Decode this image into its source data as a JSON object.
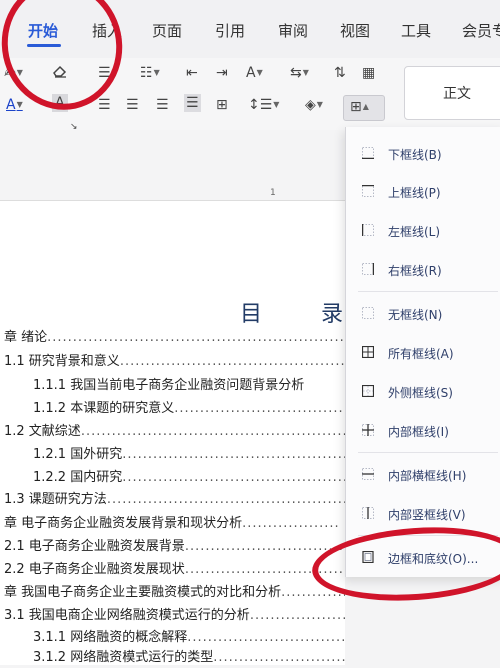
{
  "menu": {
    "items": [
      "开始",
      "插入",
      "页面",
      "引用",
      "审阅",
      "视图",
      "工具",
      "会员专"
    ],
    "active": "开始"
  },
  "toolbar": {
    "style_label": "正文",
    "icons": [
      "format-painter-icon",
      "eraser-icon",
      "bullet-list-icon",
      "number-list-icon",
      "outdent-icon",
      "indent-icon",
      "font-size-icon",
      "sort-icon",
      "text-direction-icon",
      "table-icon",
      "font-color-icon",
      "highlight-icon",
      "align-left-icon",
      "align-center-icon",
      "align-right-icon",
      "justify-icon",
      "distribute-icon",
      "line-spacing-icon",
      "shading-icon",
      "border-icon"
    ]
  },
  "ruler": {
    "marker": "1"
  },
  "document": {
    "toc_title": "目  录",
    "entries": [
      {
        "text": "章  绪论",
        "dots": "........................................................................"
      },
      {
        "text": "1.1    研究背景和意义",
        "dots": "................................................................"
      },
      {
        "text": "1.1.1 我国当前电子商务企业融资问题背景分析",
        "dots": ""
      },
      {
        "text": "1.1.2 本课题的研究意义",
        "dots": "................................................"
      },
      {
        "text": "1.2 文献综述",
        "dots": "........................................................................."
      },
      {
        "text": "1.2.1 国外研究",
        "dots": "..........................................................."
      },
      {
        "text": "1.2.2 国内研究",
        "dots": "..........................................................."
      },
      {
        "text": "1.3 课题研究方法",
        "dots": "..................................................................."
      },
      {
        "text": "章  电子商务企业融资发展背景和现状分析",
        "dots": "..................."
      },
      {
        "text": "2.1  电子商务企业融资发展背景",
        "dots": "........................................"
      },
      {
        "text": "2.2  电子商务企业融资发展现状",
        "dots": "........................................"
      },
      {
        "text": "章  我国电子商务企业主要融资模式的对比和分析",
        "dots": "....................."
      },
      {
        "text": "3.1  我国电商企业网络融资模式运行的分析",
        "dots": "......................"
      },
      {
        "text": "3.1.1 网络融资的概念解释",
        "dots": "............................................"
      },
      {
        "text": "3.1.2  网络融资模式运行的类型",
        "dots": "...................................."
      }
    ]
  },
  "border_menu": {
    "items": [
      {
        "label": "下框线(B)",
        "icon": "bottom-border-icon"
      },
      {
        "label": "上框线(P)",
        "icon": "top-border-icon"
      },
      {
        "label": "左框线(L)",
        "icon": "left-border-icon"
      },
      {
        "label": "右框线(R)",
        "icon": "right-border-icon"
      },
      {
        "label": "无框线(N)",
        "icon": "no-border-icon"
      },
      {
        "label": "所有框线(A)",
        "icon": "all-borders-icon"
      },
      {
        "label": "外侧框线(S)",
        "icon": "outside-borders-icon"
      },
      {
        "label": "内部框线(I)",
        "icon": "inside-borders-icon"
      },
      {
        "label": "内部横框线(H)",
        "icon": "inside-horizontal-border-icon"
      },
      {
        "label": "内部竖框线(V)",
        "icon": "inside-vertical-border-icon"
      },
      {
        "label": "边框和底纹(O)...",
        "icon": "borders-and-shading-icon"
      }
    ]
  },
  "colors": {
    "accent": "#2a5bd7",
    "annotation": "#d0142a",
    "menu_text": "#2f3f6a"
  }
}
